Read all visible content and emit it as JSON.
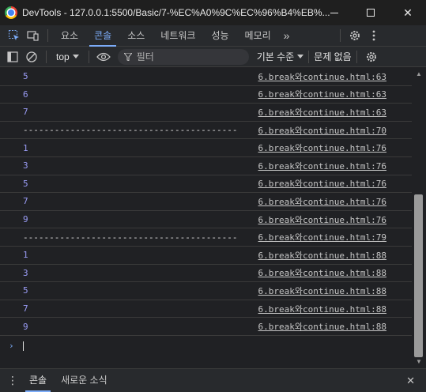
{
  "window": {
    "title": "DevTools - 127.0.0.1:5500/Basic/7-%EC%A0%9C%EC%96%B4%EB%...",
    "minimize_label": "—",
    "close_label": "✕"
  },
  "tabs": [
    {
      "label": "요소"
    },
    {
      "label": "콘솔"
    },
    {
      "label": "소스"
    },
    {
      "label": "네트워크"
    },
    {
      "label": "성능"
    },
    {
      "label": "메모리"
    }
  ],
  "more_tabs_label": "»",
  "toolbar": {
    "context": "top",
    "filter_placeholder": "필터",
    "levels": "기본 수준",
    "issues": "문제 없음"
  },
  "console": {
    "rows": [
      {
        "message": "5",
        "source": "6.break와continue.html:63"
      },
      {
        "message": "6",
        "source": "6.break와continue.html:63"
      },
      {
        "message": "7",
        "source": "6.break와continue.html:63"
      },
      {
        "message": "-----------------------------------------",
        "source": "6.break와continue.html:70"
      },
      {
        "message": "1",
        "source": "6.break와continue.html:76"
      },
      {
        "message": "3",
        "source": "6.break와continue.html:76"
      },
      {
        "message": "5",
        "source": "6.break와continue.html:76"
      },
      {
        "message": "7",
        "source": "6.break와continue.html:76"
      },
      {
        "message": "9",
        "source": "6.break와continue.html:76"
      },
      {
        "message": "-----------------------------------------",
        "source": "6.break와continue.html:79"
      },
      {
        "message": "1",
        "source": "6.break와continue.html:88"
      },
      {
        "message": "3",
        "source": "6.break와continue.html:88"
      },
      {
        "message": "5",
        "source": "6.break와continue.html:88"
      },
      {
        "message": "7",
        "source": "6.break와continue.html:88"
      },
      {
        "message": "9",
        "source": "6.break와continue.html:88"
      }
    ],
    "prompt_symbol": "›"
  },
  "drawer": {
    "tabs": [
      {
        "label": "콘솔"
      },
      {
        "label": "새로운 소식"
      }
    ],
    "close_label": "✕"
  },
  "colors": {
    "accent": "#7cacf8",
    "number_output": "#9a9cf5",
    "background": "#202124"
  }
}
